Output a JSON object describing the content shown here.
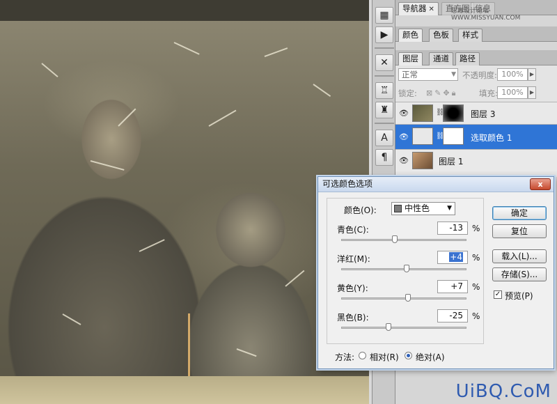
{
  "panels": {
    "top_tabs": [
      {
        "label": "导航器",
        "closable": true
      },
      {
        "label": "直方图",
        "closable": false
      },
      {
        "label": "信息",
        "closable": false
      }
    ],
    "watermark": "思缘设计论坛 WWW.MISSYUAN.COM",
    "color_tabs": [
      "颜色",
      "色板",
      "样式"
    ],
    "layer_tabs": [
      "图层",
      "通道",
      "路径"
    ],
    "layers_panel": {
      "blend_mode": "正常",
      "opacity_label": "不透明度:",
      "opacity_value": "100%",
      "lock_label": "锁定:",
      "fill_label": "填充:",
      "fill_value": "100%",
      "layers": [
        {
          "name": "图层 3",
          "selected": false
        },
        {
          "name": "选取颜色 1",
          "selected": true
        },
        {
          "name": "图层 1",
          "selected": false
        }
      ]
    }
  },
  "dialog": {
    "title": "可选颜色选项",
    "close_label": "x",
    "color_label": "颜色(O):",
    "color_value": "中性色",
    "sliders": [
      {
        "label": "青色(C):",
        "value": "-13",
        "unit": "%",
        "fraction": 0.43
      },
      {
        "label": "洋红(M):",
        "value": "+4",
        "unit": "%",
        "fraction": 0.52
      },
      {
        "label": "黄色(Y):",
        "value": "+7",
        "unit": "%",
        "fraction": 0.535
      },
      {
        "label": "黑色(B):",
        "value": "-25",
        "unit": "%",
        "fraction": 0.375
      }
    ],
    "buttons": {
      "ok": "确定",
      "reset": "复位",
      "load": "载入(L)...",
      "save": "存储(S)..."
    },
    "preview_label": "预览(P)",
    "preview_checked": true,
    "method_label": "方法:",
    "method_relative": "相对(R)",
    "method_absolute": "绝对(A)",
    "method_selected": "absolute"
  },
  "footer_logo": "UiBQ.CoM"
}
